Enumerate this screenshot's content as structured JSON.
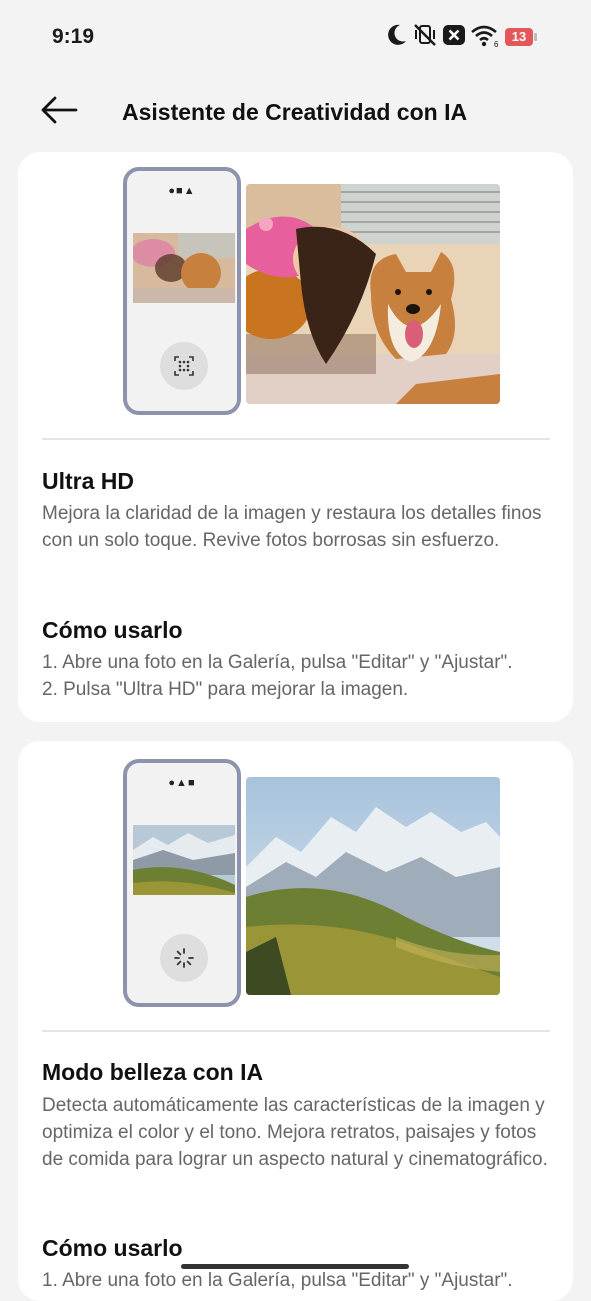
{
  "status_bar": {
    "time": "9:19",
    "battery": "13",
    "icons": [
      "moon-icon",
      "vibrate-off-icon",
      "close-box-icon",
      "wifi-icon",
      "battery-icon"
    ]
  },
  "header": {
    "title": "Asistente de Creatividad con IA",
    "back_icon": "arrow-left-icon"
  },
  "cards": [
    {
      "title": "Ultra HD",
      "description": "Mejora la claridad de la imagen y restaura los detalles finos con un solo toque. Revive fotos borrosas sin esfuerzo.",
      "howto_title": "Cómo usarlo",
      "step1": "1. Abre una foto en la Galería, pulsa \"Editar\" y \"Ajustar\".",
      "step2": "2. Pulsa \"Ultra HD\" para mejorar la imagen.",
      "phone_button_icon": "ultra-hd-scan-icon",
      "image_subject": "girl-with-shiba-dog"
    },
    {
      "title": "Modo belleza con IA",
      "description": "Detecta automáticamente las características de la imagen y optimiza el color y el tono. Mejora retratos, paisajes y fotos de comida para lograr un aspecto natural y cinematográfico.",
      "howto_title": "Cómo usarlo",
      "step1": "1. Abre una foto en la Galería, pulsa \"Editar\" y \"Ajustar\".",
      "phone_button_icon": "sparkle-spinner-icon",
      "image_subject": "mountain-landscape"
    }
  ],
  "colors": {
    "background": "#f3f3f3",
    "card": "#ffffff",
    "phone_frame": "#8d92ad",
    "battery": "#e25757",
    "body_text": "#666666"
  }
}
